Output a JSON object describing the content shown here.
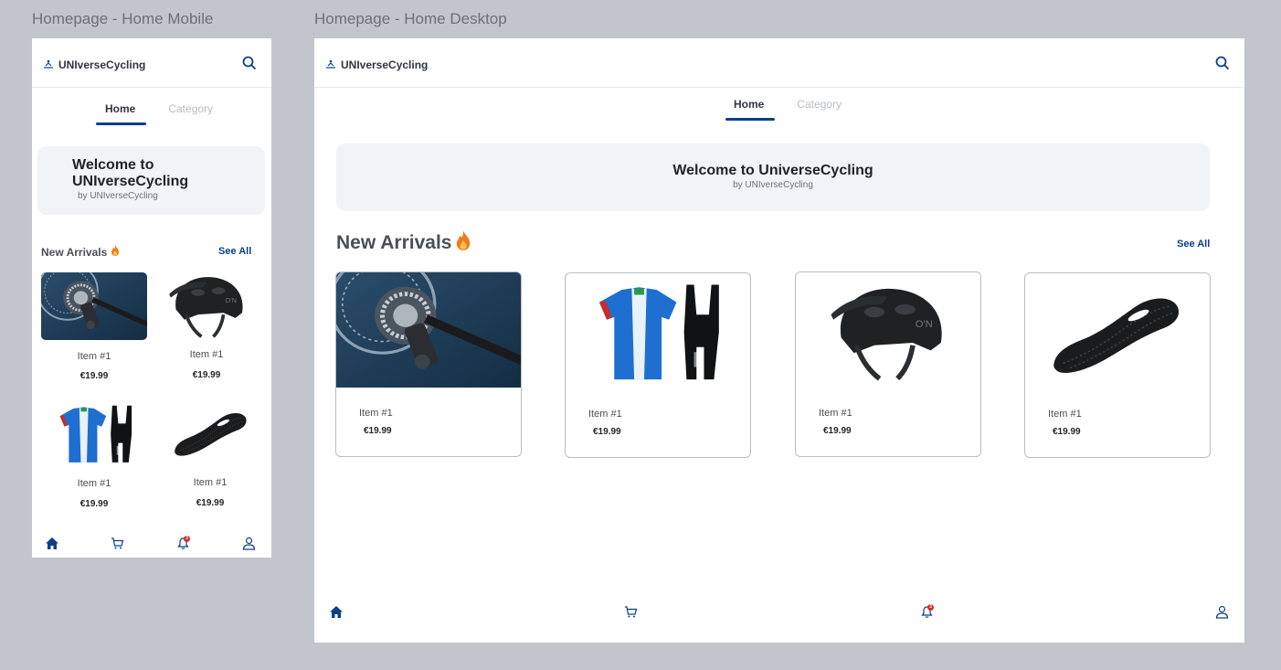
{
  "frames": {
    "mobile_title": "Homepage - Home Mobile",
    "desktop_title": "Homepage - Home Desktop"
  },
  "brand": {
    "name": "UNIverseCycling"
  },
  "tabs": {
    "home": "Home",
    "category": "Category"
  },
  "mobile": {
    "welcome_title": "Welcome to UNIverseCycling",
    "welcome_sub": "by UNIverseCycling",
    "new_arrivals": "New Arrivals",
    "see_all": "See All",
    "items": [
      {
        "label": "Item #1",
        "price": "€19.99",
        "image": "gears"
      },
      {
        "label": "Item #1",
        "price": "€19.99",
        "image": "helmet"
      },
      {
        "label": "Item #1",
        "price": "€19.99",
        "image": "kit"
      },
      {
        "label": "Item #1",
        "price": "€19.99",
        "image": "saddle"
      }
    ],
    "notification_count": "3"
  },
  "desktop": {
    "welcome_title": "Welcome to UniverseCycling",
    "welcome_sub": "by UNIverseCycling",
    "new_arrivals": "New Arrivals",
    "see_all": "See All",
    "items": [
      {
        "label": "Item #1",
        "price": "€19.99",
        "image": "gears"
      },
      {
        "label": "Item #1",
        "price": "€19.99",
        "image": "kit"
      },
      {
        "label": "Item #1",
        "price": "€19.99",
        "image": "helmet"
      },
      {
        "label": "Item #1",
        "price": "€19.99",
        "image": "saddle"
      }
    ],
    "notification_count": "3"
  },
  "colors": {
    "accent": "#0b3f8a",
    "badge": "#d62828",
    "banner": "#f2f3f6"
  },
  "icons": [
    "logo-icon",
    "search-icon",
    "fire-icon",
    "home-icon",
    "cart-icon",
    "bell-icon",
    "user-icon"
  ]
}
